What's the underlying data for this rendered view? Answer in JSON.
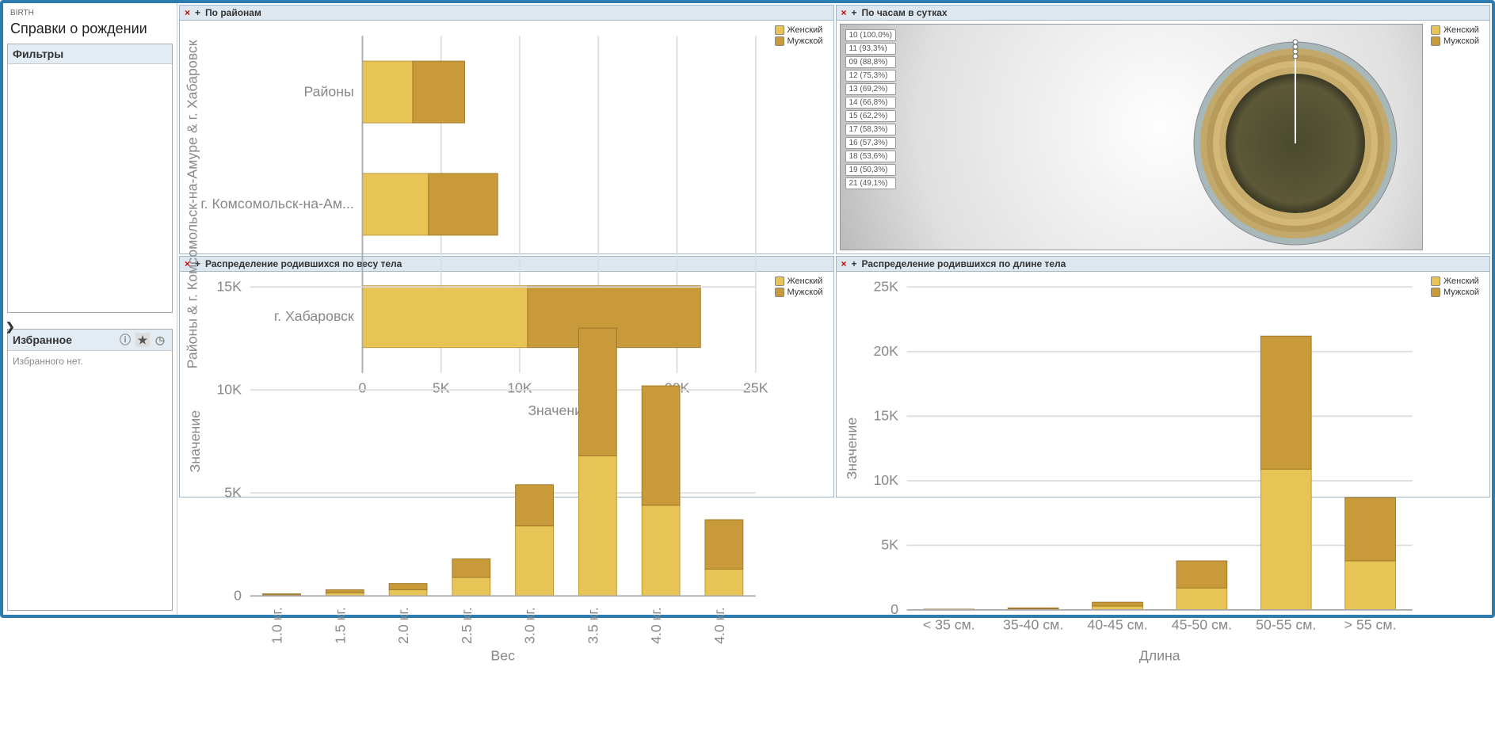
{
  "sidebar": {
    "breadcrumb": "BIRTH",
    "title": "Справки о рождении",
    "filters_label": "Фильтры",
    "favorites_label": "Избранное",
    "favorites_empty": "Избранного нет."
  },
  "legend": {
    "female": "Женский",
    "male": "Мужской"
  },
  "chart_data": [
    {
      "id": "regions",
      "title": "По районам",
      "type": "bar",
      "orientation": "horizontal",
      "stacked": true,
      "xlabel": "Значение",
      "ylabel": "Районы & г. Комсомольск-на-Амуре & г. Хабаровск",
      "xlim": [
        0,
        25000
      ],
      "xticks": [
        0,
        5000,
        10000,
        15000,
        20000,
        25000
      ],
      "xtick_labels": [
        "0",
        "5K",
        "10K",
        "15K",
        "20K",
        "25K"
      ],
      "categories": [
        "Районы",
        "г. Комсомольск-на-Ам...",
        "г. Хабаровск"
      ],
      "series": [
        {
          "name": "Женский",
          "values": [
            3200,
            4200,
            10500
          ]
        },
        {
          "name": "Мужской",
          "values": [
            3300,
            4400,
            11000
          ]
        }
      ]
    },
    {
      "id": "hours",
      "title": "По часам в сутках",
      "type": "pie",
      "labels": [
        "10 (100,0%)",
        "11 (93,3%)",
        "09 (88,8%)",
        "12 (75,3%)",
        "13 (69,2%)",
        "14 (66,8%)",
        "15 (62,2%)",
        "17 (58,3%)",
        "16 (57,3%)",
        "18 (53,6%)",
        "19 (50,3%)",
        "21 (49,1%)"
      ],
      "series": [
        {
          "name": "Женский"
        },
        {
          "name": "Мужской"
        }
      ]
    },
    {
      "id": "weight",
      "title": "Распределение родившихся по весу тела",
      "type": "bar",
      "orientation": "vertical",
      "stacked": true,
      "xlabel": "Вес",
      "ylabel": "Значение",
      "ylim": [
        0,
        15000
      ],
      "yticks": [
        0,
        5000,
        10000,
        15000
      ],
      "ytick_labels": [
        "0",
        "5K",
        "10K",
        "15K"
      ],
      "categories": [
        "1.0 кг.",
        "1.5 кг.",
        "2.0 кг.",
        "2.5 кг.",
        "3.0 кг.",
        "3.5 кг.",
        "4.0 кг.",
        "4.0 кг."
      ],
      "series": [
        {
          "name": "Женский",
          "values": [
            50,
            150,
            300,
            900,
            3400,
            6800,
            4400,
            1300
          ]
        },
        {
          "name": "Мужской",
          "values": [
            50,
            150,
            300,
            900,
            2000,
            6200,
            5800,
            2400
          ]
        }
      ]
    },
    {
      "id": "length",
      "title": "Распределение родившихся по длине тела",
      "type": "bar",
      "orientation": "vertical",
      "stacked": true,
      "xlabel": "Длина",
      "ylabel": "Значение",
      "ylim": [
        0,
        25000
      ],
      "yticks": [
        0,
        5000,
        10000,
        15000,
        20000,
        25000
      ],
      "ytick_labels": [
        "0",
        "5K",
        "10K",
        "15K",
        "20K",
        "25K"
      ],
      "categories": [
        "< 35 см.",
        "35-40 см.",
        "40-45 см.",
        "45-50 см.",
        "50-55 см.",
        "> 55 см."
      ],
      "series": [
        {
          "name": "Женский",
          "values": [
            30,
            80,
            300,
            1700,
            10900,
            3800
          ]
        },
        {
          "name": "Мужской",
          "values": [
            30,
            80,
            300,
            2100,
            10300,
            4900
          ]
        }
      ]
    }
  ]
}
